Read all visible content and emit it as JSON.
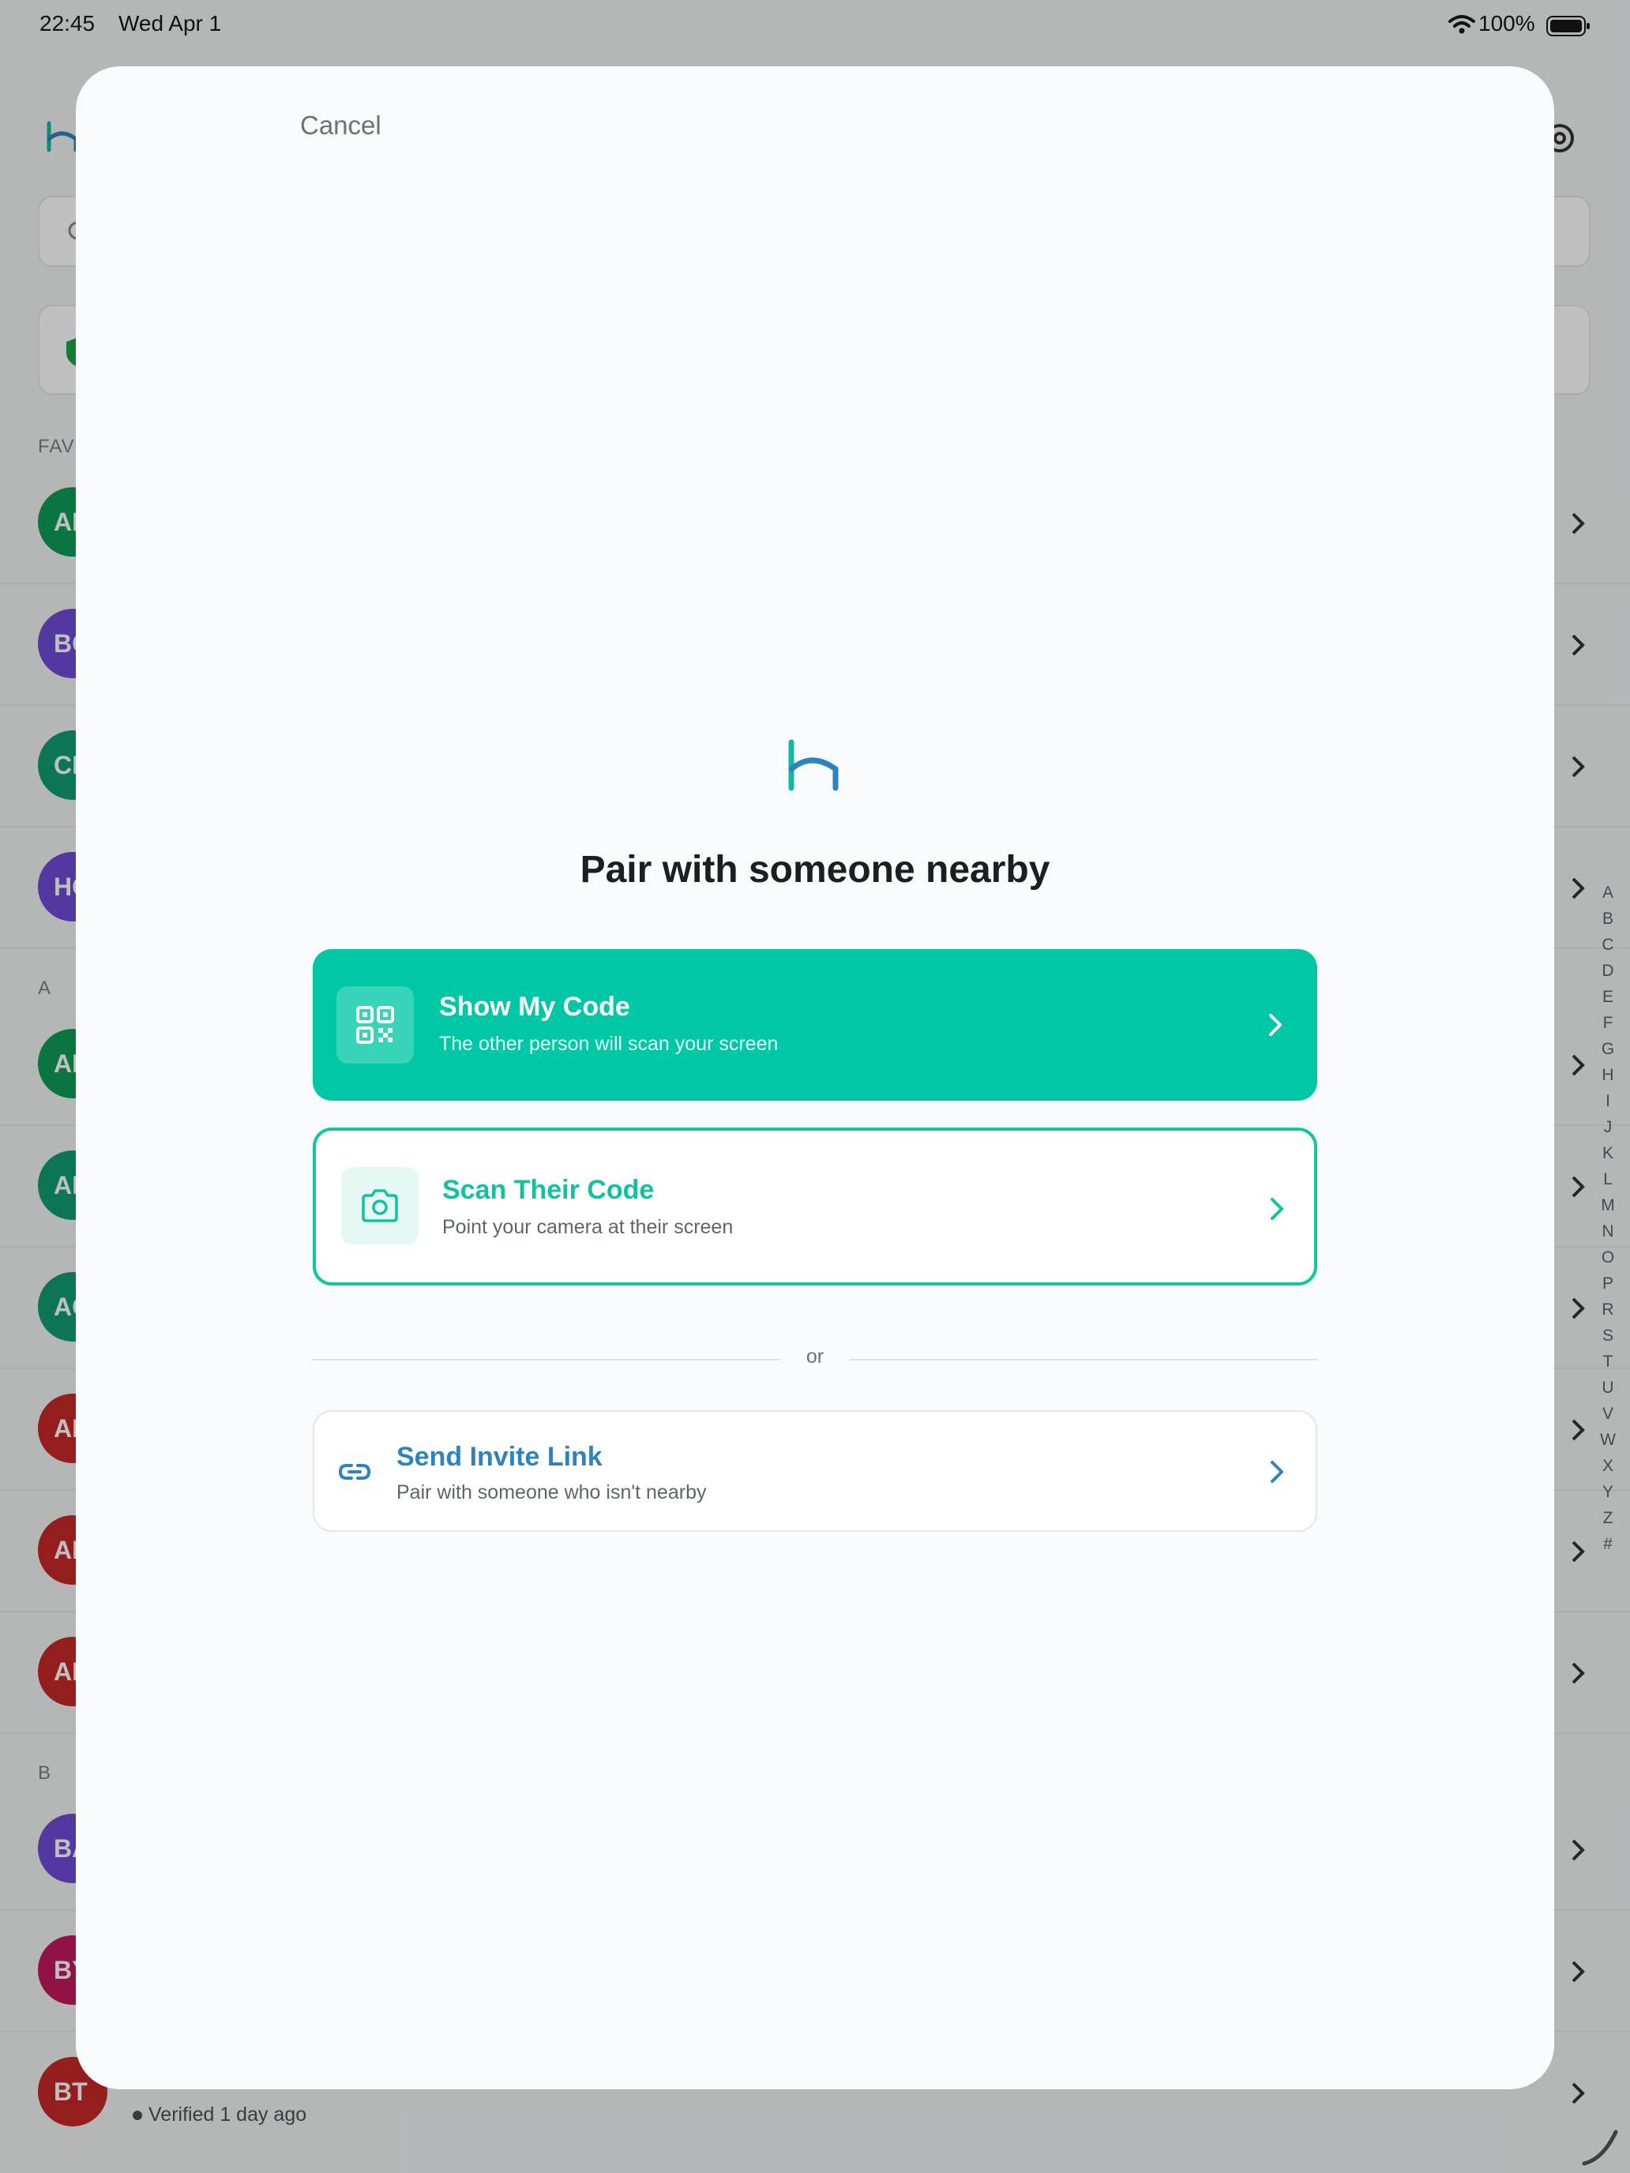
{
  "status_bar": {
    "time": "22:45",
    "date": "Wed Apr 1",
    "battery": "100%"
  },
  "background": {
    "sections": {
      "favorites_label": "FAVORITES",
      "a_label": "A",
      "b_label": "B"
    },
    "contacts": [
      {
        "initials": "AB",
        "color": "#0f9d58"
      },
      {
        "initials": "BC",
        "color": "#6f4bd8"
      },
      {
        "initials": "CD",
        "color": "#0f9d72"
      },
      {
        "initials": "HG",
        "color": "#6f4bd8"
      },
      {
        "initials": "AB",
        "color": "#0f9d58"
      },
      {
        "initials": "AB",
        "color": "#0f9d72"
      },
      {
        "initials": "AC",
        "color": "#0f9d72"
      },
      {
        "initials": "AD",
        "color": "#c62828"
      },
      {
        "initials": "AE",
        "color": "#c62828"
      },
      {
        "initials": "AF",
        "color": "#c62828"
      },
      {
        "initials": "BA",
        "color": "#6f4bd8"
      },
      {
        "initials": "BY",
        "color": "#c2185b"
      },
      {
        "initials": "BT",
        "color": "#c62828"
      }
    ],
    "verified_text": "Verified 1 day ago",
    "index_letters": [
      "A",
      "B",
      "C",
      "D",
      "E",
      "F",
      "G",
      "H",
      "I",
      "J",
      "K",
      "L",
      "M",
      "N",
      "O",
      "P",
      "R",
      "S",
      "T",
      "U",
      "V",
      "W",
      "X",
      "Y",
      "Z",
      "#"
    ]
  },
  "modal": {
    "cancel_label": "Cancel",
    "title": "Pair with someone nearby",
    "show_code": {
      "title": "Show My Code",
      "subtitle": "The other person will scan your screen",
      "icon": "qr-code-icon"
    },
    "scan_code": {
      "title": "Scan Their Code",
      "subtitle": "Point your camera at their screen",
      "icon": "camera-icon"
    },
    "divider_text": "or",
    "invite_link": {
      "title": "Send Invite Link",
      "subtitle": "Pair with someone who isn't nearby",
      "icon": "link-icon"
    }
  },
  "colors": {
    "accent": "#00c8a6",
    "link_blue": "#2f83bd"
  }
}
